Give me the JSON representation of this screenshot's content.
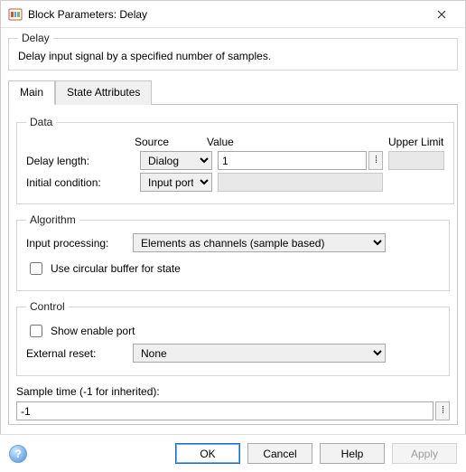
{
  "window": {
    "title": "Block Parameters: Delay"
  },
  "header": {
    "group_label": "Delay",
    "description": "Delay input signal by a specified number of samples."
  },
  "tabs": {
    "main": "Main",
    "state_attributes": "State Attributes"
  },
  "data": {
    "group_label": "Data",
    "col_source": "Source",
    "col_value": "Value",
    "col_upper": "Upper Limit",
    "delay_length_label": "Delay length:",
    "delay_length_source": "Dialog",
    "delay_length_value": "1",
    "initial_condition_label": "Initial condition:",
    "initial_condition_source": "Input port",
    "initial_condition_value": ""
  },
  "algorithm": {
    "group_label": "Algorithm",
    "input_processing_label": "Input processing:",
    "input_processing_value": "Elements as channels (sample based)",
    "circular_buffer_label": "Use circular buffer for state"
  },
  "control": {
    "group_label": "Control",
    "show_enable_port_label": "Show enable port",
    "external_reset_label": "External reset:",
    "external_reset_value": "None"
  },
  "sample_time": {
    "label": "Sample time (-1 for inherited):",
    "value": "-1"
  },
  "buttons": {
    "ok": "OK",
    "cancel": "Cancel",
    "help": "Help",
    "apply": "Apply"
  }
}
